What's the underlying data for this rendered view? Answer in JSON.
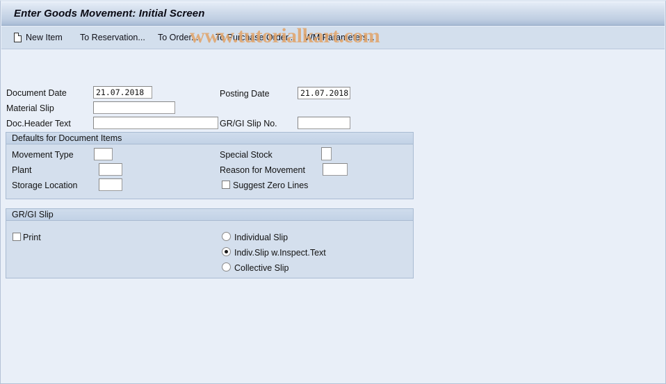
{
  "window": {
    "title": "Enter Goods Movement: Initial Screen"
  },
  "watermark": {
    "text": "www.tutorialkart.com"
  },
  "toolbar": {
    "new_item_label": "New Item",
    "new_item_icon": "document-icon",
    "to_reservation_label": "To Reservation...",
    "to_order_label": "To Order...",
    "to_purchase_order_label": "To Purchase Order...",
    "wm_parameters_label": "WM Parameters..."
  },
  "header_fields": {
    "document_date_label": "Document Date",
    "document_date_value": "21.07.2018",
    "posting_date_label": "Posting Date",
    "posting_date_value": "21.07.2018",
    "material_slip_label": "Material Slip",
    "material_slip_value": "",
    "doc_header_text_label": "Doc.Header Text",
    "doc_header_text_value": "",
    "gr_gi_slip_no_label": "GR/GI Slip No.",
    "gr_gi_slip_no_value": ""
  },
  "defaults_group": {
    "title": "Defaults for Document Items",
    "movement_type_label": "Movement Type",
    "movement_type_value": "",
    "plant_label": "Plant",
    "plant_value": "",
    "storage_location_label": "Storage Location",
    "storage_location_value": "",
    "special_stock_label": "Special Stock",
    "special_stock_value": "",
    "reason_for_movement_label": "Reason for Movement",
    "reason_for_movement_value": "",
    "suggest_zero_lines_label": "Suggest Zero Lines",
    "suggest_zero_lines_checked": false
  },
  "slip_group": {
    "title": "GR/GI Slip",
    "print_label": "Print",
    "print_checked": false,
    "options": [
      {
        "label": "Individual Slip",
        "selected": false
      },
      {
        "label": "Indiv.Slip w.Inspect.Text",
        "selected": true
      },
      {
        "label": "Collective Slip",
        "selected": false
      }
    ]
  },
  "colors": {
    "body_background": "#e9eff8",
    "titlebar_gradient_top": "#e4ecf6",
    "titlebar_gradient_bottom": "#a9bcd6",
    "toolbar_background": "#d3dfed",
    "group_background": "#d4dfed",
    "group_border": "#a9bbd2",
    "field_background": "#ffffff",
    "field_border": "#9a9a9a",
    "text": "#111111",
    "watermark": "#e2a469"
  }
}
